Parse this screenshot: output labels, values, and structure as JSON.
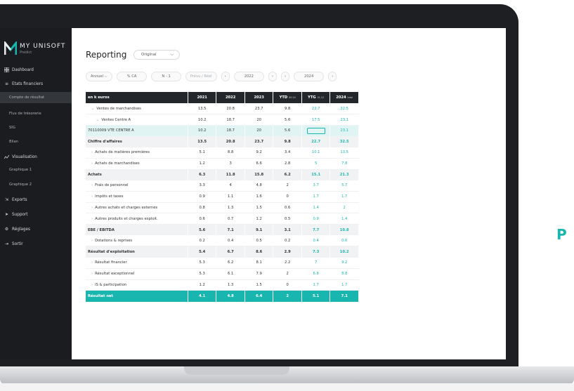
{
  "app": {
    "logo_title": "MY UNISOFT",
    "logo_subtitle": "Predict"
  },
  "sidebar": {
    "items": [
      {
        "label": "Dashboard",
        "icon": "grid-icon"
      },
      {
        "label": "Etats financiers",
        "icon": "list-icon"
      },
      {
        "label": "Compte de résultat",
        "icon": ""
      },
      {
        "label": "Flux de trésorerie",
        "icon": ""
      },
      {
        "label": "SIG",
        "icon": ""
      },
      {
        "label": "Bilan",
        "icon": ""
      },
      {
        "label": "Visualisation",
        "icon": "chart-icon"
      },
      {
        "label": "Graphique 1",
        "icon": ""
      },
      {
        "label": "Graphique 2",
        "icon": ""
      },
      {
        "label": "Exports",
        "icon": "export-icon"
      },
      {
        "label": "Support",
        "icon": "send-icon"
      },
      {
        "label": "Réglages",
        "icon": "gear-icon"
      },
      {
        "label": "Sortir",
        "icon": "logout-icon"
      }
    ]
  },
  "header": {
    "title": "Reporting",
    "view_select": "Original"
  },
  "filters": {
    "period": "Annuel",
    "pct_ca": "% CA",
    "n1": "N - 1",
    "prevu_reel": "Prévu / Réel",
    "year_from": "2022",
    "year_to": "2024"
  },
  "table": {
    "columns": [
      "en k euros",
      "2021",
      "2022",
      "2023",
      "YTD",
      "YTG",
      "2024"
    ],
    "col_suffix": {
      "ytd": "09.24",
      "ytg": "31.12",
      "total": "total"
    },
    "rows": [
      {
        "label": "Ventes de marchandises",
        "values": [
          "13.5",
          "20.8",
          "23.7",
          "9.8",
          "22.7",
          "32.5"
        ]
      },
      {
        "label": "Ventes Centre A",
        "values": [
          "10.2",
          "18.7",
          "20",
          "5.6",
          "17.5",
          "23.1"
        ]
      },
      {
        "label": "70110009 VTE CENTRE A",
        "values": [
          "10.2",
          "18.7",
          "20",
          "5.6",
          "",
          "23.1"
        ]
      },
      {
        "label": "Chiffre d'affaires",
        "values": [
          "13.5",
          "20.8",
          "23.7",
          "9.8",
          "22.7",
          "32.5"
        ]
      },
      {
        "label": "Achats de matières premières",
        "values": [
          "5.1",
          "8.8",
          "9.2",
          "3.4",
          "10.1",
          "13.5"
        ]
      },
      {
        "label": "Achats de marchandises",
        "values": [
          "1.2",
          "3",
          "6.6",
          "2.8",
          "5",
          "7.8"
        ]
      },
      {
        "label": "Achats",
        "values": [
          "6.3",
          "11.8",
          "15.8",
          "6.2",
          "15.1",
          "21.3"
        ]
      },
      {
        "label": "Frais de personnel",
        "values": [
          "3.3",
          "4",
          "4.8",
          "2",
          "3.7",
          "5.7"
        ]
      },
      {
        "label": "Impôts et taxes",
        "values": [
          "0.9",
          "1.1",
          "1.6",
          "0",
          "1.7",
          "1.7"
        ]
      },
      {
        "label": "Autres achats et charges externes",
        "values": [
          "0.8",
          "1.3",
          "1.5",
          "0.6",
          "1.4",
          "2"
        ]
      },
      {
        "label": "Autres produits et charges exploit.",
        "values": [
          "0.6",
          "0.7",
          "1.2",
          "0.5",
          "0.9",
          "1.4"
        ]
      },
      {
        "label": "EBE / EBITDA",
        "values": [
          "5.6",
          "7.1",
          "9.1",
          "3.1",
          "7.7",
          "10.8"
        ]
      },
      {
        "label": "Dotations & reprises",
        "values": [
          "0.2",
          "0.4",
          "0.5",
          "0.2",
          "0.4",
          "0.6"
        ]
      },
      {
        "label": "Résultat d'exploitation",
        "values": [
          "5.4",
          "6.7",
          "8.6",
          "2.9",
          "7.3",
          "10.2"
        ]
      },
      {
        "label": "Résultat financier",
        "values": [
          "5.3",
          "6.2",
          "8.1",
          "2.2",
          "7",
          "9.2"
        ]
      },
      {
        "label": "Résultat exceptionnel",
        "values": [
          "5.3",
          "6.1",
          "7.9",
          "2",
          "6.8",
          "8.8"
        ]
      },
      {
        "label": "IS & participation",
        "values": [
          "1.2",
          "1.3",
          "1.5",
          "0",
          "1.7",
          "1.7"
        ]
      },
      {
        "label": "Résultat net",
        "values": [
          "4.1",
          "4.8",
          "6.4",
          "2",
          "5.1",
          "7.1"
        ]
      }
    ]
  },
  "aside_letter": "P",
  "colors": {
    "accent": "#19b6b0",
    "sidebar": "#1a1c20",
    "header_row": "#23262b"
  }
}
